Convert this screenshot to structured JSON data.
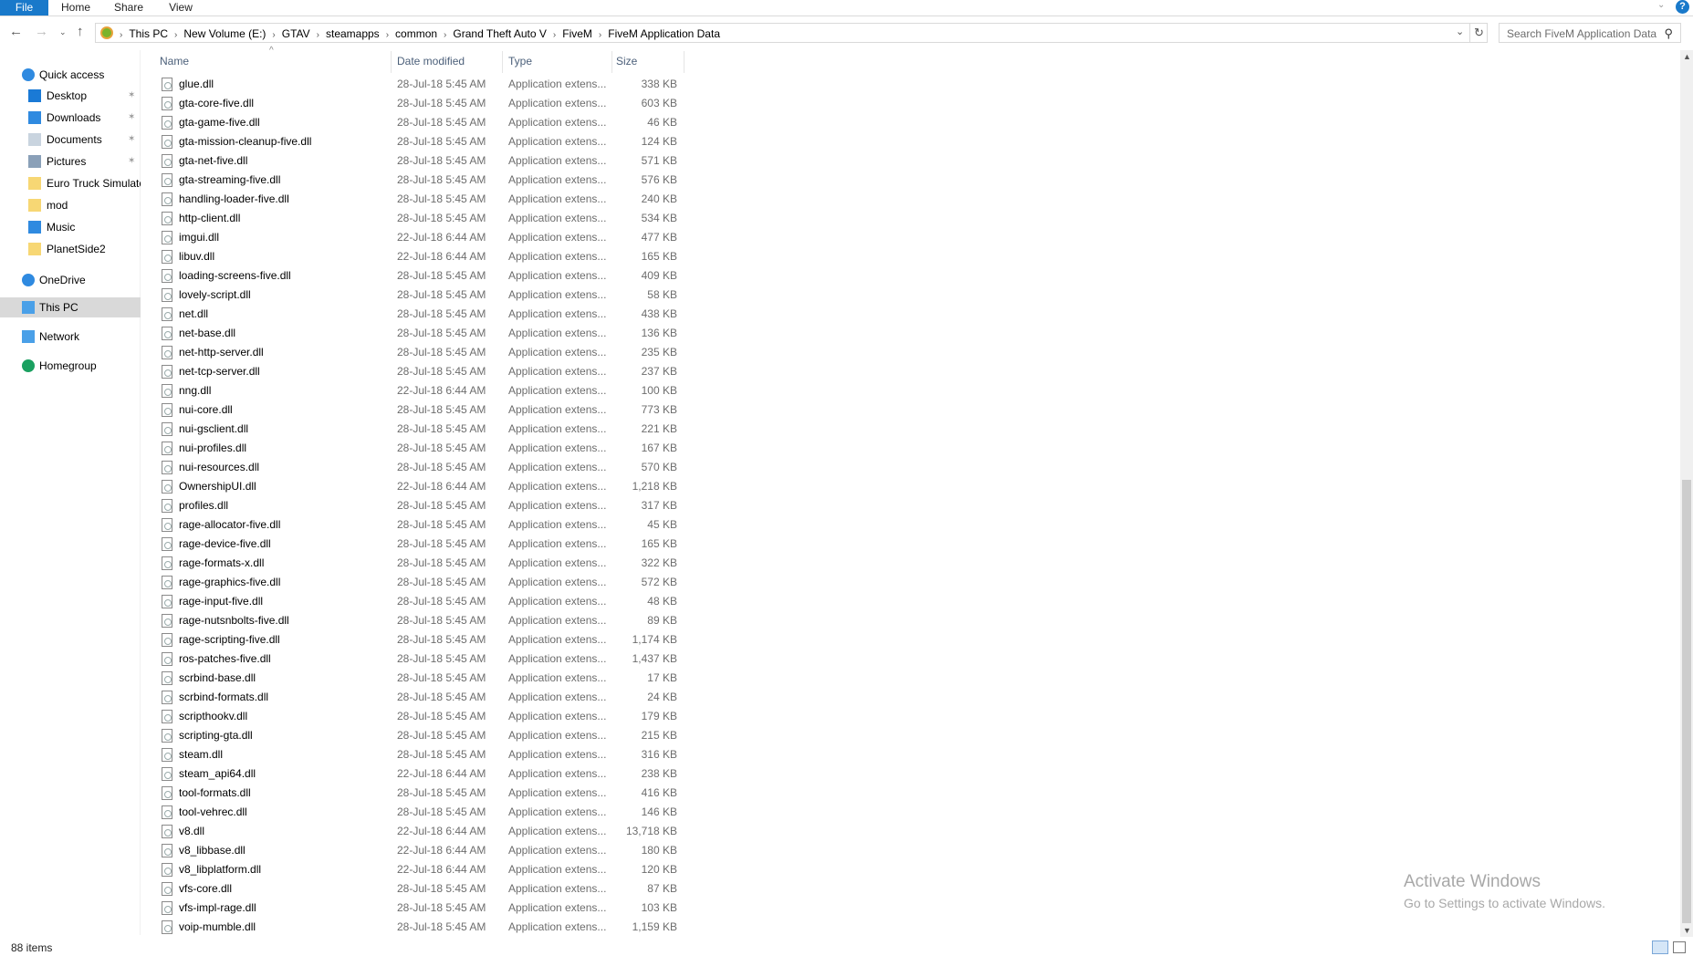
{
  "ribbon": {
    "tabs": [
      "File",
      "Home",
      "Share",
      "View"
    ]
  },
  "address": {
    "crumbs": [
      "This PC",
      "New Volume (E:)",
      "GTAV",
      "steamapps",
      "common",
      "Grand Theft Auto V",
      "FiveM",
      "FiveM Application Data"
    ]
  },
  "search": {
    "placeholder": "Search FiveM Application Data"
  },
  "nav": {
    "items": [
      {
        "label": "Quick access",
        "icon": "star-icon",
        "pinned": false
      },
      {
        "label": "Desktop",
        "icon": "desktop-icon",
        "pinned": true
      },
      {
        "label": "Downloads",
        "icon": "download-icon",
        "pinned": true
      },
      {
        "label": "Documents",
        "icon": "documents-icon",
        "pinned": true
      },
      {
        "label": "Pictures",
        "icon": "pictures-icon",
        "pinned": true
      },
      {
        "label": "Euro Truck Simulator",
        "icon": "folder-icon",
        "pinned": false
      },
      {
        "label": "mod",
        "icon": "folder-icon",
        "pinned": false
      },
      {
        "label": "Music",
        "icon": "music-icon",
        "pinned": false
      },
      {
        "label": "PlanetSide2",
        "icon": "folder-icon",
        "pinned": false
      },
      {
        "label": "OneDrive",
        "icon": "cloud-icon",
        "pinned": false
      },
      {
        "label": "This PC",
        "icon": "computer-icon",
        "pinned": false,
        "selected": true
      },
      {
        "label": "Network",
        "icon": "network-icon",
        "pinned": false
      },
      {
        "label": "Homegroup",
        "icon": "homegroup-icon",
        "pinned": false
      }
    ]
  },
  "columns": {
    "name": "Name",
    "date": "Date modified",
    "type": "Type",
    "size": "Size"
  },
  "files": [
    [
      "glue.dll",
      "28-Jul-18 5:45 AM",
      "338 KB"
    ],
    [
      "gta-core-five.dll",
      "28-Jul-18 5:45 AM",
      "603 KB"
    ],
    [
      "gta-game-five.dll",
      "28-Jul-18 5:45 AM",
      "46 KB"
    ],
    [
      "gta-mission-cleanup-five.dll",
      "28-Jul-18 5:45 AM",
      "124 KB"
    ],
    [
      "gta-net-five.dll",
      "28-Jul-18 5:45 AM",
      "571 KB"
    ],
    [
      "gta-streaming-five.dll",
      "28-Jul-18 5:45 AM",
      "576 KB"
    ],
    [
      "handling-loader-five.dll",
      "28-Jul-18 5:45 AM",
      "240 KB"
    ],
    [
      "http-client.dll",
      "28-Jul-18 5:45 AM",
      "534 KB"
    ],
    [
      "imgui.dll",
      "22-Jul-18 6:44 AM",
      "477 KB"
    ],
    [
      "libuv.dll",
      "22-Jul-18 6:44 AM",
      "165 KB"
    ],
    [
      "loading-screens-five.dll",
      "28-Jul-18 5:45 AM",
      "409 KB"
    ],
    [
      "lovely-script.dll",
      "28-Jul-18 5:45 AM",
      "58 KB"
    ],
    [
      "net.dll",
      "28-Jul-18 5:45 AM",
      "438 KB"
    ],
    [
      "net-base.dll",
      "28-Jul-18 5:45 AM",
      "136 KB"
    ],
    [
      "net-http-server.dll",
      "28-Jul-18 5:45 AM",
      "235 KB"
    ],
    [
      "net-tcp-server.dll",
      "28-Jul-18 5:45 AM",
      "237 KB"
    ],
    [
      "nng.dll",
      "22-Jul-18 6:44 AM",
      "100 KB"
    ],
    [
      "nui-core.dll",
      "28-Jul-18 5:45 AM",
      "773 KB"
    ],
    [
      "nui-gsclient.dll",
      "28-Jul-18 5:45 AM",
      "221 KB"
    ],
    [
      "nui-profiles.dll",
      "28-Jul-18 5:45 AM",
      "167 KB"
    ],
    [
      "nui-resources.dll",
      "28-Jul-18 5:45 AM",
      "570 KB"
    ],
    [
      "OwnershipUI.dll",
      "22-Jul-18 6:44 AM",
      "1,218 KB"
    ],
    [
      "profiles.dll",
      "28-Jul-18 5:45 AM",
      "317 KB"
    ],
    [
      "rage-allocator-five.dll",
      "28-Jul-18 5:45 AM",
      "45 KB"
    ],
    [
      "rage-device-five.dll",
      "28-Jul-18 5:45 AM",
      "165 KB"
    ],
    [
      "rage-formats-x.dll",
      "28-Jul-18 5:45 AM",
      "322 KB"
    ],
    [
      "rage-graphics-five.dll",
      "28-Jul-18 5:45 AM",
      "572 KB"
    ],
    [
      "rage-input-five.dll",
      "28-Jul-18 5:45 AM",
      "48 KB"
    ],
    [
      "rage-nutsnbolts-five.dll",
      "28-Jul-18 5:45 AM",
      "89 KB"
    ],
    [
      "rage-scripting-five.dll",
      "28-Jul-18 5:45 AM",
      "1,174 KB"
    ],
    [
      "ros-patches-five.dll",
      "28-Jul-18 5:45 AM",
      "1,437 KB"
    ],
    [
      "scrbind-base.dll",
      "28-Jul-18 5:45 AM",
      "17 KB"
    ],
    [
      "scrbind-formats.dll",
      "28-Jul-18 5:45 AM",
      "24 KB"
    ],
    [
      "scripthookv.dll",
      "28-Jul-18 5:45 AM",
      "179 KB"
    ],
    [
      "scripting-gta.dll",
      "28-Jul-18 5:45 AM",
      "215 KB"
    ],
    [
      "steam.dll",
      "28-Jul-18 5:45 AM",
      "316 KB"
    ],
    [
      "steam_api64.dll",
      "22-Jul-18 6:44 AM",
      "238 KB"
    ],
    [
      "tool-formats.dll",
      "28-Jul-18 5:45 AM",
      "416 KB"
    ],
    [
      "tool-vehrec.dll",
      "28-Jul-18 5:45 AM",
      "146 KB"
    ],
    [
      "v8.dll",
      "22-Jul-18 6:44 AM",
      "13,718 KB"
    ],
    [
      "v8_libbase.dll",
      "22-Jul-18 6:44 AM",
      "180 KB"
    ],
    [
      "v8_libplatform.dll",
      "22-Jul-18 6:44 AM",
      "120 KB"
    ],
    [
      "vfs-core.dll",
      "28-Jul-18 5:45 AM",
      "87 KB"
    ],
    [
      "vfs-impl-rage.dll",
      "28-Jul-18 5:45 AM",
      "103 KB"
    ],
    [
      "voip-mumble.dll",
      "28-Jul-18 5:45 AM",
      "1,159 KB"
    ]
  ],
  "file_type": "Application extens...",
  "status": {
    "count": "88 items"
  },
  "watermark": {
    "title": "Activate Windows",
    "subtitle": "Go to Settings to activate Windows."
  },
  "colors": {
    "accent": "#1979ca",
    "selected": "#d9d9d9"
  }
}
